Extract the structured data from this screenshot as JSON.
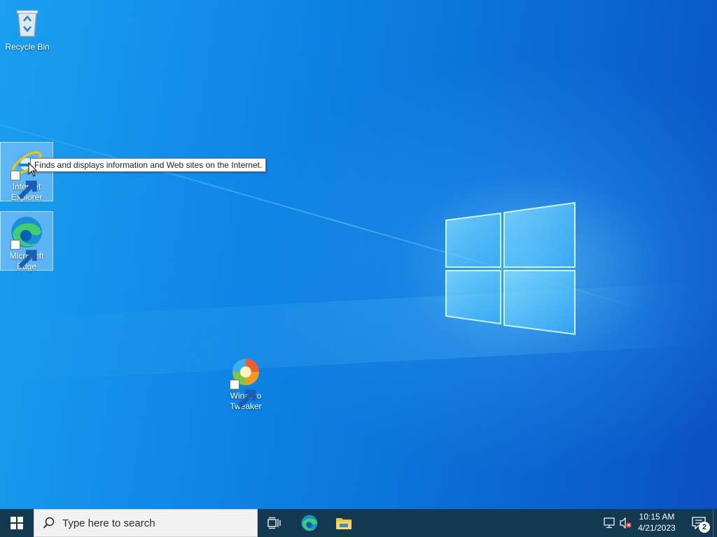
{
  "desktop": {
    "icons": [
      {
        "label": "Recycle Bin"
      },
      {
        "label": "Internet Explorer"
      },
      {
        "label": "Microsoft Edge"
      },
      {
        "label": "Winaero Tweaker"
      }
    ],
    "tooltip": "Finds and displays information and Web sites on the Internet."
  },
  "taskbar": {
    "search_placeholder": "Type here to search",
    "pinned": [
      "task-view-icon",
      "edge-icon",
      "file-explorer-icon"
    ],
    "clock": {
      "time": "10:15 AM",
      "date": "4/21/2023"
    },
    "notifications_count": "2",
    "tray_icons": [
      "network-icon",
      "volume-muted-icon"
    ]
  },
  "colors": {
    "taskbar": "#12394f",
    "desktop_accent": "#0e86e6"
  }
}
